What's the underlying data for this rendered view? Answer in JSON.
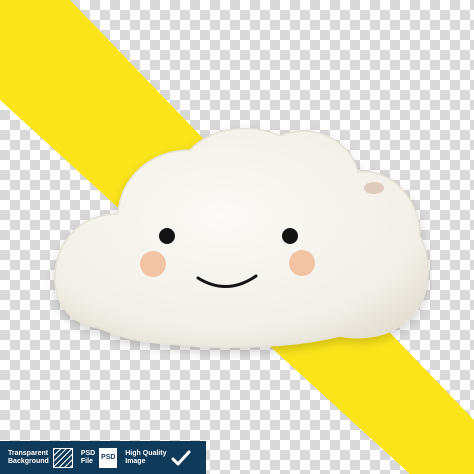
{
  "colors": {
    "yellow": "#fbe51a",
    "checker_light": "#ffffff",
    "checker_dark": "#d9d9d9",
    "bar": "#103a5a",
    "pillow": "#f7f5f0",
    "pillow_shadow": "#e4e0d6",
    "cheek": "#f2c4a3",
    "eyes": "#141414"
  },
  "infobar": {
    "transparent": {
      "line1": "Transparent",
      "line2": "Background",
      "icon": "checker-pattern-icon"
    },
    "psd": {
      "line1": "PSD",
      "line2": "File",
      "icon_label": "PSD",
      "icon": "psd-file-icon"
    },
    "quality": {
      "line1": "High Quality",
      "line2": "Image",
      "icon": "checkmark-icon"
    }
  }
}
